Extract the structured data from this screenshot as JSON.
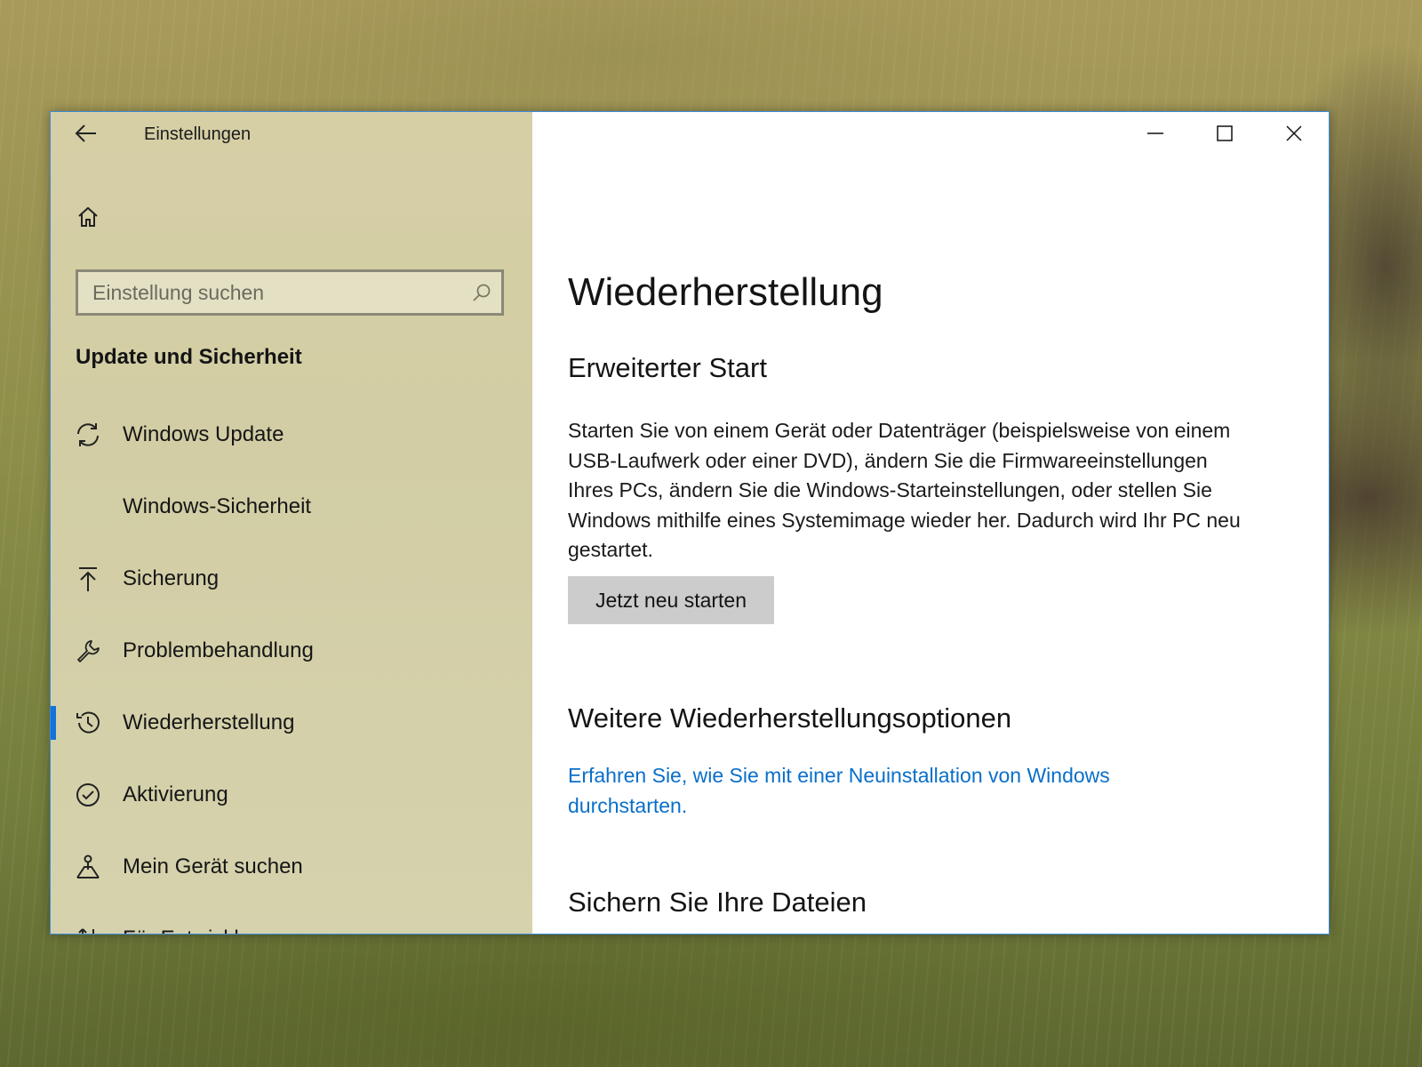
{
  "window": {
    "app_title": "Einstellungen",
    "controls": {
      "minimize": "minimize-icon",
      "maximize": "maximize-icon",
      "close": "close-icon"
    }
  },
  "sidebar": {
    "search_placeholder": "Einstellung suchen",
    "section_title": "Update und Sicherheit",
    "items": [
      {
        "label": "Windows Update",
        "icon": "sync-icon"
      },
      {
        "label": "Windows-Sicherheit",
        "icon": ""
      },
      {
        "label": "Sicherung",
        "icon": "upload-arrow-icon"
      },
      {
        "label": "Problembehandlung",
        "icon": "wrench-icon"
      },
      {
        "label": "Wiederherstellung",
        "icon": "history-icon",
        "active": true
      },
      {
        "label": "Aktivierung",
        "icon": "check-circle-icon"
      },
      {
        "label": "Mein Gerät suchen",
        "icon": "find-device-icon"
      },
      {
        "label": "Für Entwickler",
        "icon": "developer-tools-icon"
      }
    ]
  },
  "content": {
    "page_title": "Wiederherstellung",
    "advanced_start": {
      "heading": "Erweiterter Start",
      "description": "Starten Sie von einem Gerät oder Datenträger (beispielsweise von einem USB-Laufwerk oder einer DVD), ändern Sie die Firmwareeinstellungen Ihres PCs, ändern Sie die Windows-Starteinstellungen, oder stellen Sie Windows mithilfe eines Systemimage wieder her. Dadurch wird Ihr PC neu gestartet.",
      "button_label": "Jetzt neu starten"
    },
    "more_options": {
      "heading": "Weitere Wiederherstellungsoptionen",
      "link": "Erfahren Sie, wie Sie mit einer Neuinstallation von Windows durchstarten."
    },
    "backup": {
      "heading": "Sichern Sie Ihre Dateien"
    }
  },
  "colors": {
    "accent": "#1672d6",
    "link": "#0a6fc9",
    "button_bg": "#cccccc",
    "window_border": "#3b8ede"
  }
}
